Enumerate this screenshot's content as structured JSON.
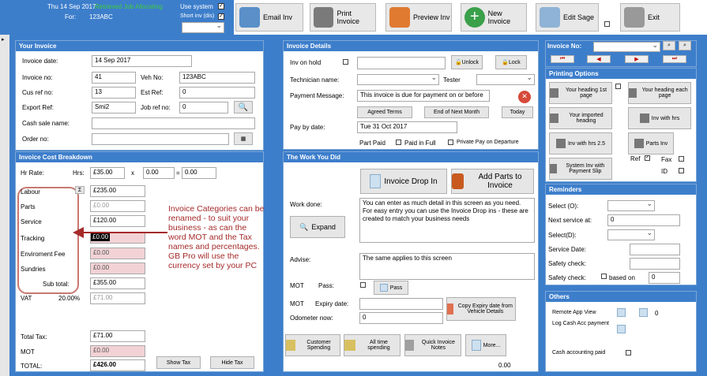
{
  "top": {
    "date": "Thu 14 Sep 2017",
    "status": "Retrieved Job Allocating",
    "for_label": "For:",
    "for_value": "123ABC",
    "use_system": "Use system",
    "short_inv": "Short inv (dis)",
    "buttons": [
      "Email Inv",
      "Print Invoice",
      "Preview Inv",
      "New Invoice",
      "Edit Sage",
      "Exit"
    ]
  },
  "your_invoice": {
    "title": "Your Invoice",
    "invoice_date_label": "Invoice date:",
    "invoice_date": "14 Sep 2017",
    "invoice_no_label": "Invoice no:",
    "invoice_no": "41",
    "veh_no_label": "Veh No:",
    "veh_no": "123ABC",
    "cus_ref_label": "Cus ref no:",
    "cus_ref": "13",
    "est_ref_label": "Est Ref:",
    "est_ref": "0",
    "export_ref_label": "Export Ref:",
    "export_ref": "Smi2",
    "job_ref_label": "Job ref no:",
    "job_ref": "0",
    "cash_sale_label": "Cash sale name:",
    "order_no_label": "Order no:"
  },
  "breakdown": {
    "title": "Invoice Cost Breakdown",
    "hr_rate_label": "Hr Rate:",
    "hrs_label": "Hrs:",
    "hr_rate": "£35.00",
    "times": "x",
    "hrs": "0.00",
    "equals": "=",
    "hr_total": "0.00",
    "sigma": "Σ",
    "rows": [
      {
        "label": "Labour",
        "value": "£235.00",
        "style": "white"
      },
      {
        "label": "Parts",
        "value": "£0.00",
        "style": "gray"
      },
      {
        "label": "Service",
        "value": "£120.00",
        "style": "white"
      },
      {
        "label": "Tracking",
        "value": "£0.00",
        "style": "black"
      },
      {
        "label": "Enviroment Fee",
        "value": "£0.00",
        "style": "pink"
      },
      {
        "label": "Sundries",
        "value": "£0.00",
        "style": "pink"
      }
    ],
    "subtotal_label": "Sub total:",
    "subtotal": "£355.00",
    "vat_label": "VAT",
    "vat_rate": "20.00%",
    "vat_value": "£71.00",
    "total_tax_label": "Total Tax:",
    "total_tax": "£71.00",
    "mot_label": "MOT",
    "mot": "£0.00",
    "total_label": "TOTAL:",
    "total": "£426.00",
    "show_tax": "Show Tax",
    "hide_tax": "Hide Tax"
  },
  "annotation": "Invoice Categories can be renamed - to suit your business - as can the word MOT and the Tax names and percentages. GB Pro will use the currency set by your PC",
  "invoice_details": {
    "title": "Invoice Details",
    "inv_on_hold": "Inv on hold",
    "unlock": "Unlock",
    "lock": "Lock",
    "technician_label": "Technician name:",
    "tester_label": "Tester",
    "payment_msg_label": "Payment Message:",
    "payment_msg": "This invoice is due for payment on or before",
    "agreed_terms": "Agreed Terms",
    "end_next_month": "End of Next Month",
    "today": "Today",
    "pay_by_label": "Pay by date:",
    "pay_by": "Tue 31 Oct 2017",
    "part_paid": "Part Paid",
    "paid_full": "Paid in Full",
    "private_pay": "Private Pay on Departure"
  },
  "work": {
    "title": "The Work You Did",
    "invoice_drop_in": "Invoice Drop In",
    "add_parts": "Add Parts to Invoice",
    "work_done_label": "Work done:",
    "work_done": "You can enter as much detail in this screen as you need. For easy entry you can use the Invoice Drop ins - these are created to match your business needs",
    "expand": "Expand",
    "advise_label": "Advise:",
    "advise": "The same applies to this screen",
    "mot_label": "MOT",
    "pass_label": "Pass:",
    "pass_btn": "Pass",
    "expiry_label": "Expiry date:",
    "copy_expiry": "Copy Expiry date from Vehicle Details",
    "odometer_label": "Odometer now:",
    "odometer": "0",
    "customer_spending": "Customer Spending",
    "all_time": "All time spending",
    "quick_notes": "Quick Invoice Notes",
    "more": "More...",
    "bottom_value": "0.00"
  },
  "right": {
    "invoice_no_label": "Invoice No:",
    "printing_title": "Printing Options",
    "opt1": "Your heading 1st page",
    "opt2": "Your heading each page",
    "opt3": "Your imported heading",
    "opt4": "Inv with hrs",
    "opt5": "Inv with hrs 2.5",
    "opt6": "Parts Inv",
    "opt7": "System Inv with Payment Slip",
    "ref_label": "Ref",
    "fax_label": "Fax",
    "id_label": "ID",
    "reminders_title": "Reminders",
    "select_o": "Select (O):",
    "next_service": "Next service at:",
    "next_service_val": "0",
    "select_d": "Select(D):",
    "service_date": "Service Date:",
    "safety_check": "Safety check:",
    "safety_check2": "Safety check:",
    "based_on": "based on",
    "based_val": "0",
    "others_title": "Others",
    "remote_app": "Remote App View",
    "remote_val": "0",
    "log_cash": "Log Cash Acc payment",
    "cash_paid": "Cash accounting paid"
  }
}
